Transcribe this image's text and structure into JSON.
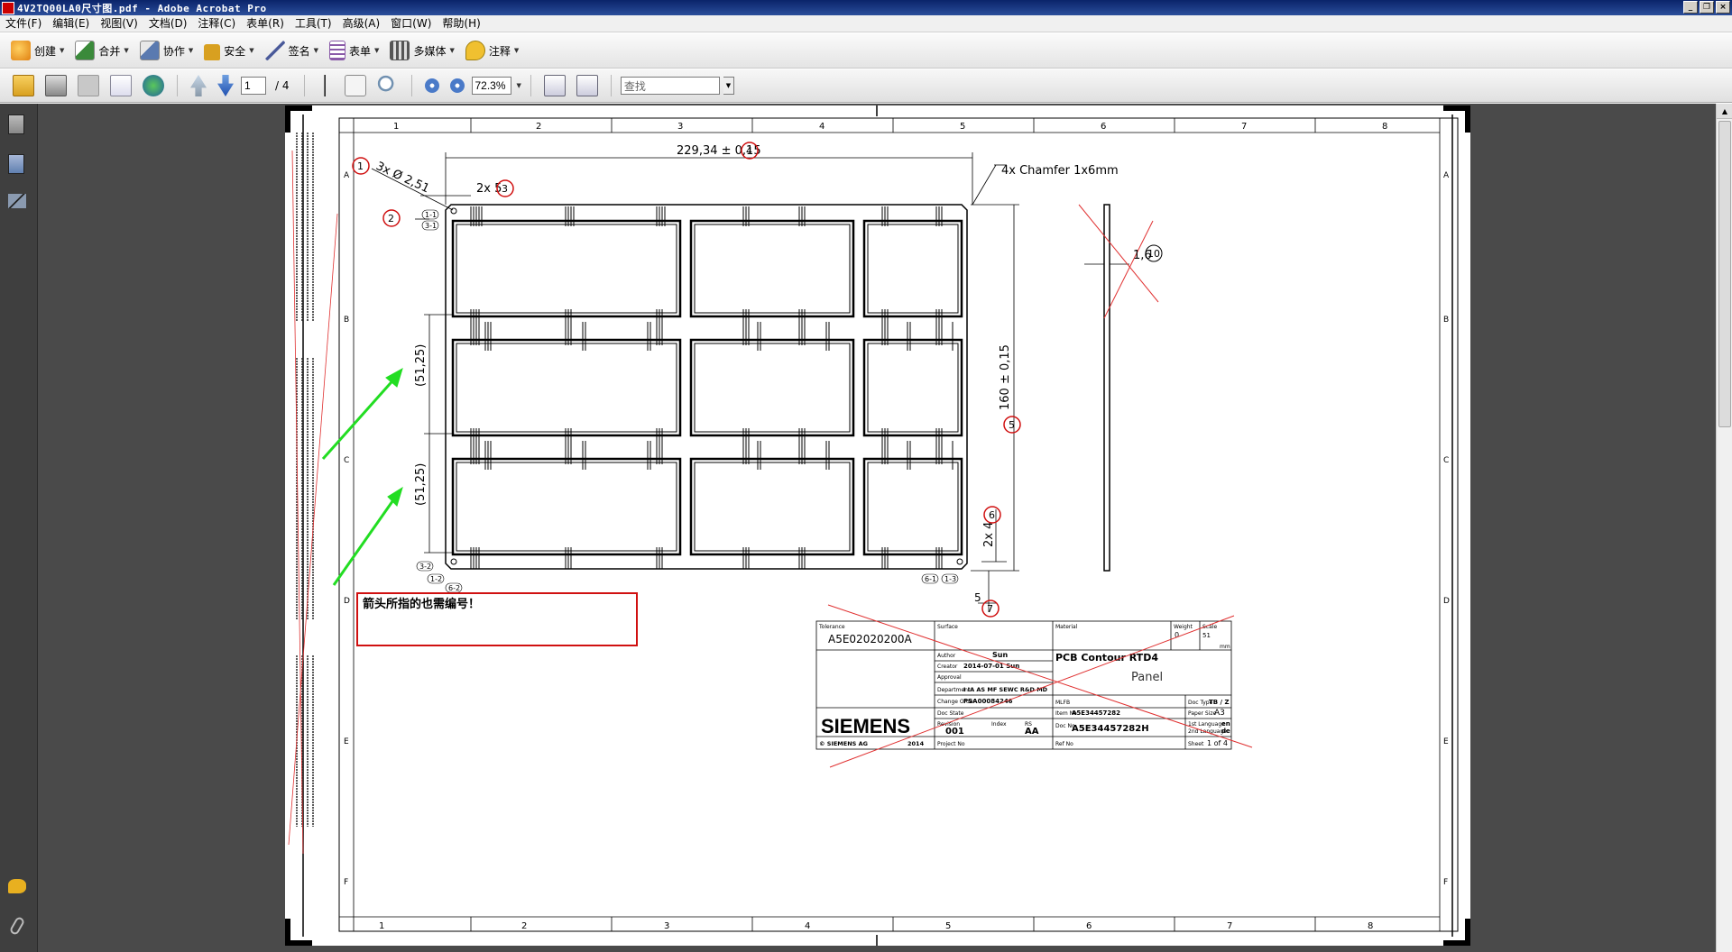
{
  "window": {
    "title": "4V2TQ00LA0尺寸图.pdf - Adobe Acrobat Pro",
    "controls": [
      "_",
      "❐",
      "×"
    ]
  },
  "menu": [
    "文件(F)",
    "编辑(E)",
    "视图(V)",
    "文档(D)",
    "注释(C)",
    "表单(R)",
    "工具(T)",
    "高级(A)",
    "窗口(W)",
    "帮助(H)"
  ],
  "tasks": [
    {
      "label": "创建",
      "icon": "create-icon",
      "color": "#e8a020"
    },
    {
      "label": "合并",
      "icon": "combine-icon",
      "color": "#3a8a3a"
    },
    {
      "label": "协作",
      "icon": "collaborate-icon",
      "color": "#5a7ab0"
    },
    {
      "label": "安全",
      "icon": "lock-icon",
      "color": "#d8a020"
    },
    {
      "label": "签名",
      "icon": "pen-icon",
      "color": "#4a5a9a"
    },
    {
      "label": "表单",
      "icon": "forms-icon",
      "color": "#8a5aa8"
    },
    {
      "label": "多媒体",
      "icon": "multimedia-icon",
      "color": "#d89020"
    },
    {
      "label": "注释",
      "icon": "comment-icon",
      "color": "#e8b020"
    }
  ],
  "nav": {
    "page_current": "1",
    "page_total": "/ 4",
    "zoom": "72.3%",
    "find_placeholder": "查找"
  },
  "drawing": {
    "callout_text": "箭头所指的也需编号！",
    "dim_width": "229,34 ± 0,15",
    "dim_chamfer": "4x  Chamfer  1x6mm",
    "dim_holes": "3x  Ø 2,51",
    "dim_2x5": "2x 5",
    "dim_height": "160 ± 0,15",
    "dim_pitch": "(51,25)",
    "dim_2x4": "2x 4",
    "dim_5": "5",
    "dim_thickness": "1,6",
    "balloons": [
      "1",
      "2",
      "3",
      "4",
      "5",
      "6",
      "7",
      "10"
    ],
    "datum_labels": [
      "1-1",
      "3-1",
      "3-2",
      "1-2",
      "6-2",
      "6-1",
      "1-3"
    ],
    "col_numbers": [
      "1",
      "2",
      "3",
      "4",
      "5",
      "6",
      "7",
      "8"
    ],
    "row_letters": [
      "A",
      "B",
      "C",
      "D",
      "E",
      "F"
    ]
  },
  "titleblock": {
    "tolerance_label": "Tolerance",
    "tolerance": "A5E02020200A",
    "surface_label": "Surface",
    "material_label": "Material",
    "weight_label": "Weight",
    "weight": "0",
    "scale_label": "Scale",
    "scale": "51",
    "mm": "mm",
    "author_label": "Author",
    "author": "Sun",
    "creator_label": "Creator",
    "creator": "2014-07-01   Sun",
    "approval_label": "Approval",
    "department_label": "Department",
    "department": "I IA AS MF SEWC R&D MD",
    "change_order_label": "Change Order",
    "change_order": "PSA00084246",
    "doc_state_label": "Doc State",
    "revision_label": "Revision",
    "revision": "001",
    "index_label": "Index",
    "index": "RS",
    "index_val": "AA",
    "project_label": "Project No",
    "title": "PCB Contour RTD4",
    "subtitle": "Panel",
    "mlfb_label": "MLFB",
    "item_no_label": "Item No",
    "item_no": "A5E34457282",
    "doc_no_label": "Doc No",
    "doc_no": "A5E34457282H",
    "ref_no_label": "Ref No",
    "doc_type_label": "Doc Type",
    "doc_type": "TB / Z",
    "paper_label": "Paper Size",
    "paper": "A3",
    "lang1_label": "1st Language",
    "lang1": "en",
    "lang2_label": "2nd Language",
    "lang2": "de",
    "sheet_label": "Sheet",
    "sheet": "1 of 4",
    "company": "SIEMENS",
    "copyright": "© SIEMENS AG",
    "year": "2014"
  },
  "colors": {
    "accent_red": "#d01010",
    "arrow_green": "#22dd22",
    "ui_dark": "#3f3f3f"
  }
}
